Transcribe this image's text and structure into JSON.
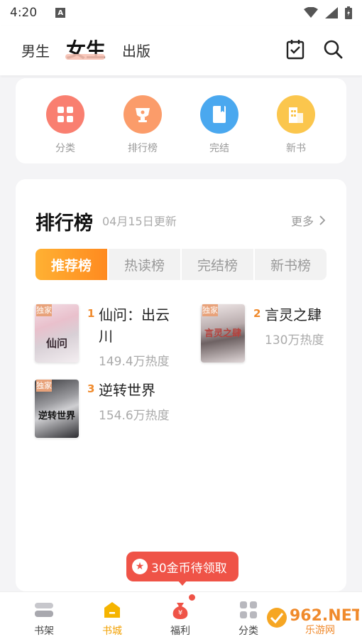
{
  "status": {
    "time": "4:20",
    "notif": "A"
  },
  "nav": {
    "tabs": [
      "男生",
      "女生",
      "出版"
    ],
    "active": 1
  },
  "categories": [
    {
      "label": "分类",
      "icon": "grid-icon",
      "color": "#f97f70"
    },
    {
      "label": "排行榜",
      "icon": "trophy-icon",
      "color": "#fb9c6a"
    },
    {
      "label": "完结",
      "icon": "book-icon",
      "color": "#4aa8ef"
    },
    {
      "label": "新书",
      "icon": "building-icon",
      "color": "#fbc64d"
    }
  ],
  "ranking": {
    "title": "排行榜",
    "updated": "04月15日更新",
    "more": "更多",
    "tabs": [
      "推荐榜",
      "热读榜",
      "完结榜",
      "新书榜"
    ],
    "books": [
      {
        "rank": "1",
        "title": "仙问：出云川",
        "heat": "149.4万热度",
        "badge": "独家",
        "cover_text": "仙问"
      },
      {
        "rank": "2",
        "title": "言灵之肆",
        "heat": "130万热度",
        "badge": "独家",
        "cover_text": "言灵之肆"
      },
      {
        "rank": "3",
        "title": "逆转世界",
        "heat": "154.6万热度",
        "badge": "独家",
        "cover_text": "逆转世界"
      }
    ]
  },
  "reward": {
    "label": "30金币待领取"
  },
  "bottom_nav": [
    "书架",
    "书城",
    "福利",
    "分类"
  ],
  "watermark": {
    "brand": "962.NET",
    "sub": "乐游网"
  },
  "colors": {
    "accent": "#f2a000",
    "red": "#ef5347",
    "tab_orange": "#ff8a1f"
  }
}
